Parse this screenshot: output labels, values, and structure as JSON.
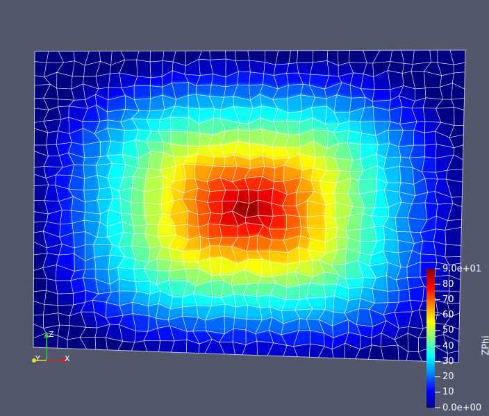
{
  "view": {
    "background": "#52576b",
    "mesh_edge_color": "#ffffff"
  },
  "field": {
    "name": "ZPhi",
    "min": 0,
    "max": 90,
    "colormap": "jet"
  },
  "colorbar": {
    "title": "ZPhi",
    "ticks": [
      {
        "value": 90,
        "label": "9.0e+01"
      },
      {
        "value": 80,
        "label": "80"
      },
      {
        "value": 70,
        "label": "70"
      },
      {
        "value": 60,
        "label": "60"
      },
      {
        "value": 50,
        "label": "50"
      },
      {
        "value": 40,
        "label": "40"
      },
      {
        "value": 30,
        "label": "30"
      },
      {
        "value": 20,
        "label": "20"
      },
      {
        "value": 10,
        "label": "10"
      },
      {
        "value": 0,
        "label": "0.0e+00"
      }
    ]
  },
  "orientation_axes": {
    "z_label": "Z",
    "y_label": "Y",
    "x_label": "X",
    "z_color": "#2fd13f",
    "y_color": "#e6e61e",
    "x_color": "#e01e1e"
  }
}
